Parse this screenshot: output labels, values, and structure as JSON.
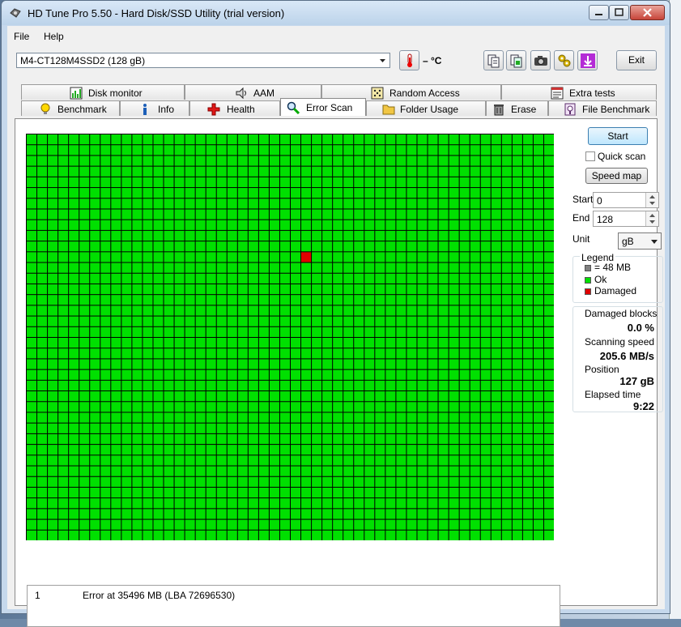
{
  "window": {
    "title": "HD Tune Pro 5.50 - Hard Disk/SSD Utility (trial version)",
    "min_icon": "minimize-icon",
    "max_icon": "maximize-icon",
    "close_icon": "close-icon"
  },
  "menu": {
    "file": "File",
    "help": "Help"
  },
  "toolbar": {
    "drive": "M4-CT128M4SSD2 (128 gB)",
    "temperature": "– °C",
    "exit_label": "Exit",
    "buttons": [
      "copy-text-icon",
      "copy-info-icon",
      "screenshot-icon",
      "options-icon",
      "save-icon"
    ]
  },
  "tabs": {
    "top": [
      {
        "label": "Disk monitor",
        "icon": "disk-monitor-icon"
      },
      {
        "label": "AAM",
        "icon": "speaker-icon"
      },
      {
        "label": "Random Access",
        "icon": "dice-icon"
      },
      {
        "label": "Extra tests",
        "icon": "extra-tests-icon"
      }
    ],
    "bottom": [
      {
        "label": "Benchmark",
        "icon": "bulb-icon"
      },
      {
        "label": "Info",
        "icon": "info-icon"
      },
      {
        "label": "Health",
        "icon": "health-cross-icon"
      },
      {
        "label": "Error Scan",
        "icon": "magnifier-icon"
      },
      {
        "label": "Folder Usage",
        "icon": "folder-icon"
      },
      {
        "label": "Erase",
        "icon": "trash-icon"
      },
      {
        "label": "File Benchmark",
        "icon": "file-benchmark-icon"
      }
    ],
    "active": "Error Scan"
  },
  "scan_map": {
    "columns": 50,
    "rows": 38,
    "ok_color": "#00e000",
    "damaged_color": "#e00000",
    "damaged_blocks": [
      {
        "row": 11,
        "col": 26
      }
    ]
  },
  "controls": {
    "start_label": "Start",
    "quick_scan_label": "Quick scan",
    "quick_scan_checked": false,
    "speed_map_label": "Speed map",
    "start_field_label": "Start",
    "start_value": "0",
    "end_field_label": "End",
    "end_value": "128",
    "unit_label": "Unit",
    "unit_value": "gB"
  },
  "legend": {
    "title": "Legend",
    "block_size": "= 48 MB",
    "ok": "Ok",
    "damaged": "Damaged",
    "block_color": "#808080"
  },
  "stats": {
    "damaged_blocks_label": "Damaged blocks",
    "damaged_blocks_value": "0.0 %",
    "scanning_speed_label": "Scanning speed",
    "scanning_speed_value": "205.6 MB/s",
    "position_label": "Position",
    "position_value": "127 gB",
    "elapsed_label": "Elapsed time",
    "elapsed_value": "9:22"
  },
  "log": [
    {
      "num": "1",
      "text": "Error at 35496 MB (LBA 72696530)"
    }
  ]
}
